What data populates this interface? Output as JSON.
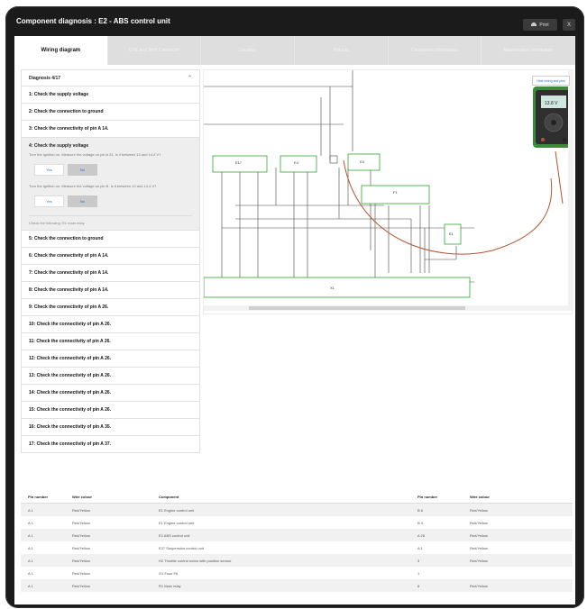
{
  "window": {
    "title": "Component diagnosis : E2 - ABS control unit",
    "print_label": "Print",
    "close_label": "X"
  },
  "tabs": [
    {
      "label": "Wiring diagram",
      "active": true
    },
    {
      "label": "OTE and Tech Connector",
      "active": false
    },
    {
      "label": "Location",
      "active": false
    },
    {
      "label": "Pinouts",
      "active": false
    },
    {
      "label": "Component Information",
      "active": false
    },
    {
      "label": "Maintenance information",
      "active": false
    }
  ],
  "diagnosis": {
    "header": "Diagnosis 4/17",
    "steps_before": [
      "1: Check the supply voltage",
      "2: Check the connection to ground",
      "3: Check the connectivity of pin A 14."
    ],
    "open_step": {
      "title": "4: Check the supply voltage",
      "instruction1": "Turn the ignition on. Measure the voltage on pin A 34. Is it between 13 and 14.4 V?",
      "instruction2": "Turn the ignition on. Measure the voltage on pin B. Is it between 13 and 14.4 V?",
      "yes_label": "Yes",
      "no_label": "No",
      "check_following": "Check the following: R1 main relay"
    },
    "steps_after": [
      "5: Check the connection to ground",
      "6: Check the connectivity of pin A 14.",
      "7: Check the connectivity of pin A 14.",
      "8: Check the connectivity of pin A 14.",
      "9: Check the connectivity of pin A 26.",
      "10: Check the connectivity of pin A 26.",
      "11: Check the connectivity of pin A 26.",
      "12: Check the connectivity of pin A 26.",
      "13: Check the connectivity of pin A 26.",
      "14: Check the connectivity of pin A 26.",
      "15: Check the connectivity of pin A 26.",
      "16: Check the connectivity of pin A 35.",
      "17: Check the connectivity of pin A 37."
    ]
  },
  "diagram": {
    "meter_button": "Hide wiring and pins",
    "meter_reading": "13.8 V",
    "components": {
      "e17": "E17",
      "e4": "E4",
      "e4b": "E4",
      "f1": "F1",
      "e1": "E1",
      "x1": "X1"
    },
    "colors": {
      "component_outline": "#2fa52f",
      "wire": "#444444",
      "probe_wire": "#b2562f",
      "meter_body": "#3d8a3a",
      "meter_screen": "#cfe7e0"
    }
  },
  "pin_table": {
    "headers": [
      "Pin number",
      "Wire colour",
      "Component",
      "Pin number",
      "Wire colour"
    ],
    "rows": [
      [
        "A 1",
        "Red/Yellow",
        "E1 Engine control unit",
        "B 6",
        "Red/Yellow"
      ],
      [
        "A 1",
        "Red/Yellow",
        "E1 Engine control unit",
        "B 4",
        "Red/Yellow"
      ],
      [
        "A 1",
        "Red/Yellow",
        "E2 ABS control unit",
        "A 28",
        "Red/Yellow"
      ],
      [
        "A 1",
        "Red/Yellow",
        "E37 Suspension control unit",
        "A 1",
        "Red/Yellow"
      ],
      [
        "A 1",
        "Red/Yellow",
        "H2 Throttle control motor with position sensor",
        "3",
        "Red/Yellow"
      ],
      [
        "A 1",
        "Red/Yellow",
        "G1 Fuse F6",
        "1",
        ""
      ],
      [
        "A 1",
        "Red/Yellow",
        "R1 Main relay",
        "8",
        "Red/Yellow"
      ]
    ]
  }
}
